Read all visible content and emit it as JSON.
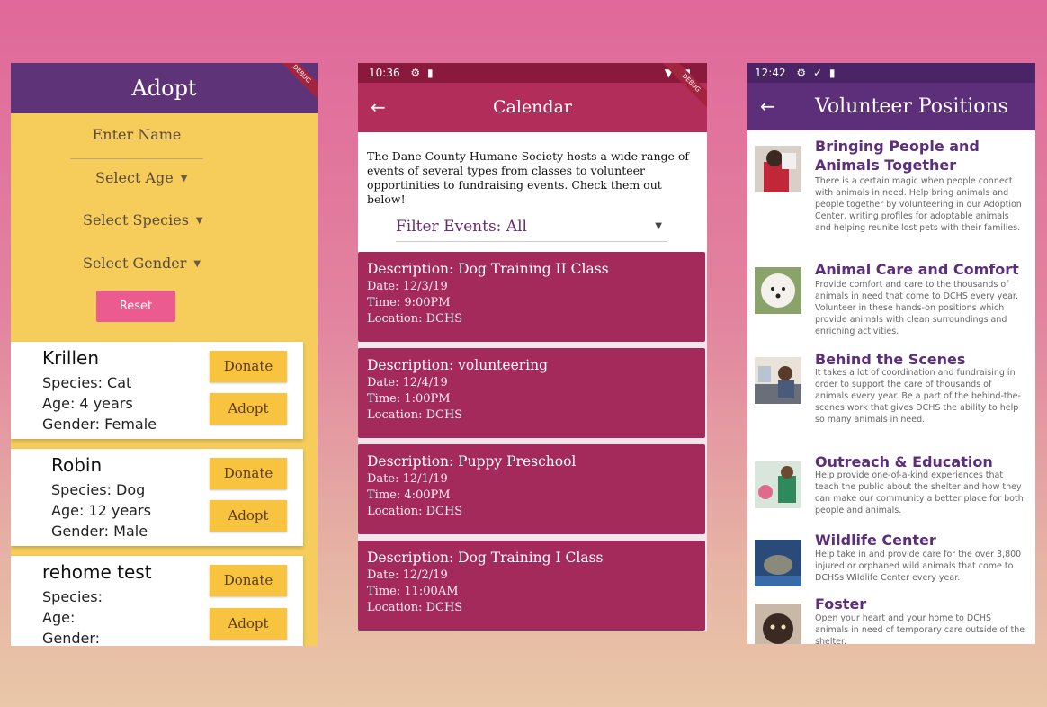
{
  "adopt": {
    "title": "Adopt",
    "ribbon": "DEBUG",
    "name_placeholder": "Enter Name",
    "age_select": "Select Age",
    "species_select": "Select Species",
    "gender_select": "Select Gender",
    "reset_label": "Reset",
    "donate_label": "Donate",
    "adopt_label": "Adopt",
    "pets": [
      {
        "name": "Krillen",
        "species": "Species: Cat",
        "age": "Age: 4 years",
        "gender": "Gender: Female"
      },
      {
        "name": "Robin",
        "species": "Species: Dog",
        "age": "Age: 12 years",
        "gender": "Gender: Male"
      },
      {
        "name": "rehome test",
        "species": "Species:",
        "age": "Age:",
        "gender": "Gender:"
      }
    ]
  },
  "calendar": {
    "time": "10:36",
    "title": "Calendar",
    "ribbon": "DEBUG",
    "intro": "The Dane County Humane Society hosts a wide range of events of several types from classes to volunteer opportinities to fundraising events. Check them out below!",
    "filter_label": "Filter Events: All",
    "events": [
      {
        "description": "Description: Dog Training II Class",
        "date": "Date: 12/3/19",
        "time": "Time: 9:00PM",
        "location": "Location: DCHS"
      },
      {
        "description": "Description: volunteering",
        "date": "Date: 12/4/19",
        "time": "Time: 1:00PM",
        "location": "Location: DCHS"
      },
      {
        "description": "Description: Puppy Preschool",
        "date": "Date: 12/1/19",
        "time": "Time: 4:00PM",
        "location": "Location: DCHS"
      },
      {
        "description": "Description: Dog Training I Class",
        "date": "Date: 12/2/19",
        "time": "Time: 11:00AM",
        "location": "Location: DCHS"
      }
    ]
  },
  "volunteer": {
    "time": "12:42",
    "title": "Volunteer Positions",
    "positions": [
      {
        "title": "Bringing People and Animals Together",
        "desc": "There is a certain magic when people connect with animals in need. Help bring animals and people together by volunteering in our Adoption Center, writing profiles for adoptable animals and helping reunite lost pets with their families."
      },
      {
        "title": "Animal Care and Comfort",
        "desc": "Provide comfort and care to the thousands of animals in need that come to DCHS every year. Volunteer in these hands-on positions which provide animals with clean surroundings and enriching activities."
      },
      {
        "title": "Behind the Scenes",
        "desc": "It takes a lot of coordination and fundraising in order to support the care of thousands of animals every year. Be a part of the behind-the-scenes work that gives DCHS the ability to help so many animals in need."
      },
      {
        "title": "Outreach & Education",
        "desc": "Help provide one-of-a-kind experiences that teach the public about the shelter and how they can make our community a better place for both people and animals."
      },
      {
        "title": "Wildlife Center",
        "desc": "Help take in and provide care for the over 3,800 injured or orphaned wild animals that come to DCHSs Wildlife Center every year."
      },
      {
        "title": "Foster",
        "desc": "Open your heart and your home to DCHS animals in need of temporary care outside of the shelter."
      }
    ]
  },
  "colors": {
    "adopt_bg": "#f6cc5b",
    "adopt_bar": "#5e3378",
    "calendar_bar": "#b32d5b",
    "event_card": "#a42a5b",
    "volunteer_bar": "#5d2e7a",
    "reset": "#ec5b8e",
    "button_yellow": "#f8c440"
  }
}
